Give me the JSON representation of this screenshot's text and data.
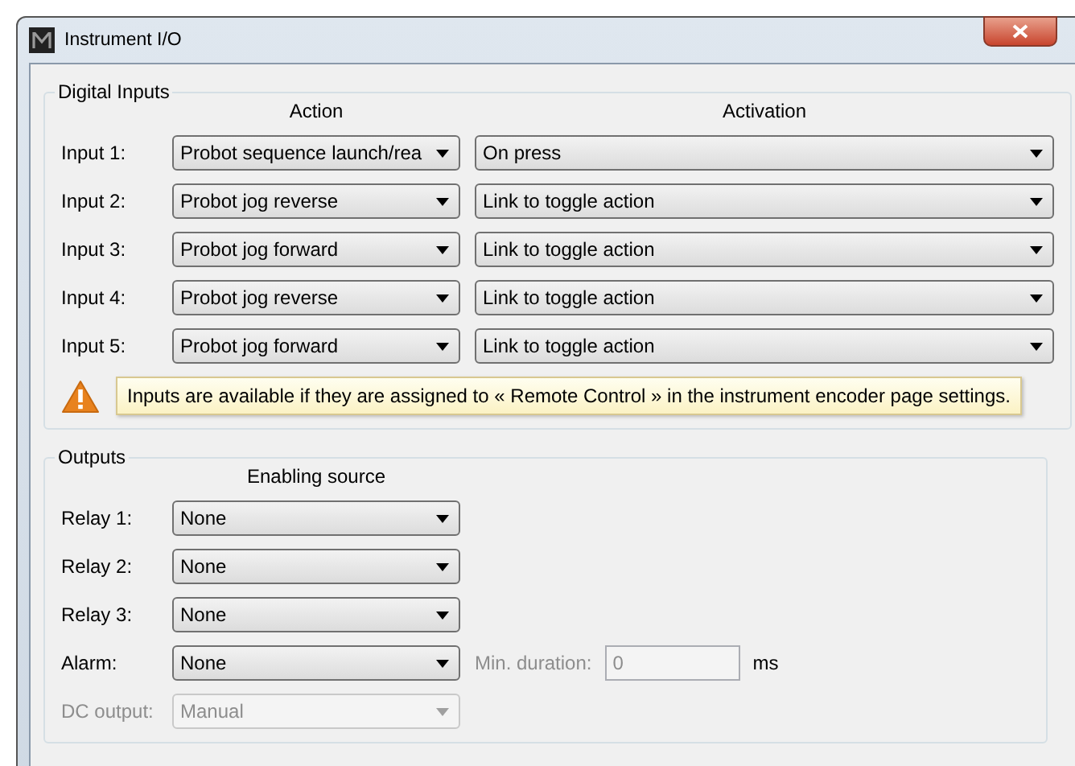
{
  "window": {
    "title": "Instrument I/O"
  },
  "digital_inputs": {
    "title": "Digital Inputs",
    "columns": [
      "Action",
      "Activation"
    ],
    "rows": [
      {
        "label": "Input 1:",
        "action": "Probot sequence launch/rea",
        "activation": "On press"
      },
      {
        "label": "Input 2:",
        "action": "Probot jog reverse",
        "activation": "Link to toggle action"
      },
      {
        "label": "Input 3:",
        "action": "Probot jog forward",
        "activation": "Link to toggle action"
      },
      {
        "label": "Input 4:",
        "action": "Probot jog reverse",
        "activation": "Link to toggle action"
      },
      {
        "label": "Input 5:",
        "action": "Probot jog forward",
        "activation": "Link to toggle action"
      }
    ],
    "warning": "Inputs are available if they are assigned to « Remote Control » in the instrument encoder page settings."
  },
  "outputs": {
    "title": "Outputs",
    "column": "Enabling source",
    "rows": [
      {
        "label": "Relay 1:",
        "value": "None",
        "disabled": false
      },
      {
        "label": "Relay 2:",
        "value": "None",
        "disabled": false
      },
      {
        "label": "Relay 3:",
        "value": "None",
        "disabled": false
      },
      {
        "label": "Alarm:",
        "value": "None",
        "disabled": false,
        "min_duration": {
          "label": "Min. duration:",
          "value": "0",
          "unit": "ms",
          "disabled": true
        }
      },
      {
        "label": "DC output:",
        "value": "Manual",
        "disabled": true
      }
    ]
  }
}
